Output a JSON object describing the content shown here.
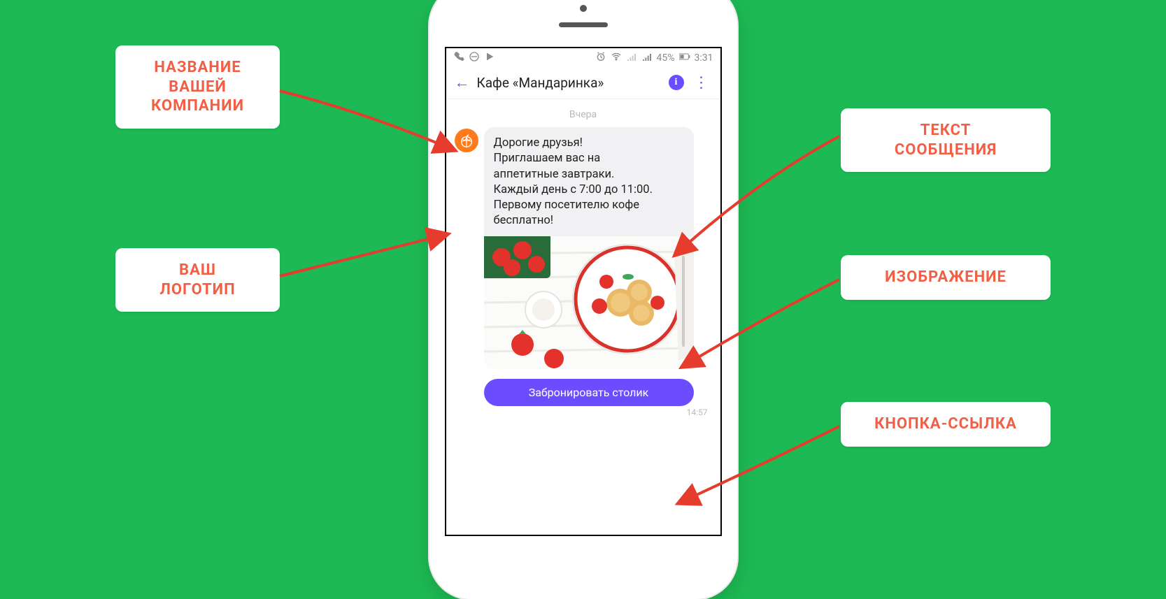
{
  "callouts": {
    "company_name": "НАЗВАНИЕ\nВАШЕЙ\nКОМПАНИИ",
    "logo": "ВАШ\nЛОГОТИП",
    "message_text": "ТЕКСТ\nСООБЩЕНИЯ",
    "image": "ИЗОБРАЖЕНИЕ",
    "button_link": "КНОПКА-ССЫЛКА"
  },
  "statusbar": {
    "battery_pct": "45%",
    "time": "3:31"
  },
  "chat": {
    "title": "Кафе «Мандаринка»",
    "date_label": "Вчера",
    "message_text": "Дорогие друзья!\nПриглашаем вас на\nаппетитные завтраки.\nКаждый день с 7:00 до 11:00.\nПервому посетителю кофе\nбесплатно!",
    "cta_label": "Забронировать столик",
    "timestamp": "14:57"
  }
}
